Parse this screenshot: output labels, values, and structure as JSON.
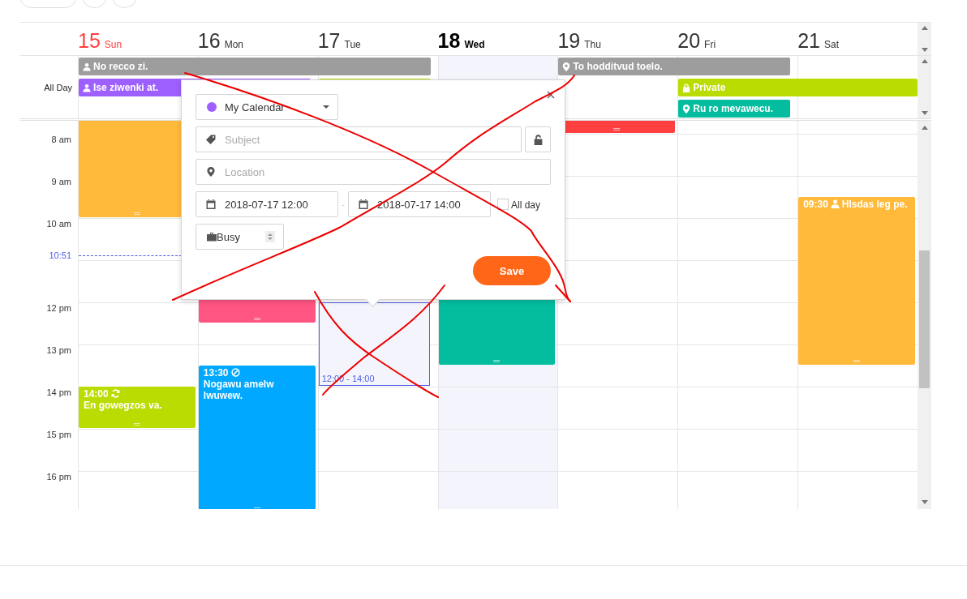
{
  "days": [
    {
      "number": "15",
      "weekday": "Sun",
      "kind": "sunday",
      "events": [
        {
          "color": "#ffba3b"
        },
        {
          "time": "14:00",
          "kind": "repeat",
          "title": "En gowegzos va.",
          "color": "#bbdc00"
        }
      ]
    },
    {
      "number": "16",
      "weekday": "Mon",
      "kind": "weekday",
      "events": [
        {
          "color": "#ff5583"
        },
        {
          "time": "13:30",
          "kind": "ban",
          "title": "Nogawu amelw lwuwew.",
          "color": "#00a9ff"
        }
      ]
    },
    {
      "number": "17",
      "weekday": "Tue",
      "kind": "weekday",
      "events": [
        {
          "kind": "selection",
          "title": "12:00 - 14:00"
        }
      ]
    },
    {
      "number": "18",
      "weekday": "Wed",
      "kind": "today",
      "events": [
        {
          "color": "#03bd9e"
        }
      ]
    },
    {
      "number": "19",
      "weekday": "Thu",
      "kind": "weekday",
      "events": [
        {
          "color": "#ff4040"
        }
      ]
    },
    {
      "number": "20",
      "weekday": "Fri",
      "kind": "weekday"
    },
    {
      "number": "21",
      "weekday": "Sat",
      "kind": "weekday",
      "events": [
        {
          "time": "09:30",
          "kind": "person",
          "title": "Hlsdas leg pe.",
          "color": "#ffba3b"
        }
      ]
    }
  ],
  "all_day_label": "All Day",
  "all_day_events": [
    {
      "kind": "person",
      "title": "No recco zi.",
      "color": "#9d9d9d"
    },
    {
      "kind": "pin",
      "title": "To hodditvud toelo.",
      "color": "#9d9d9d"
    },
    {
      "kind": "person",
      "title": "Ise ziwenki at.",
      "color": "#9e5fff"
    },
    {
      "color": "#bbdc00"
    },
    {
      "kind": "lock",
      "title": "Private",
      "color": "#bbdc00"
    },
    {
      "kind": "pin",
      "title": "Ru ro mevawecu.",
      "color": "#03bd9e"
    }
  ],
  "time_rows": [
    {
      "label": "8 am",
      "kind": "hour"
    },
    {
      "label": "9 am",
      "kind": "hour"
    },
    {
      "label": "10 am",
      "kind": "hour"
    },
    {
      "label": "10:51",
      "kind": "now"
    },
    {
      "label": "12 pm",
      "kind": "hour"
    },
    {
      "label": "13 pm",
      "kind": "hour"
    },
    {
      "label": "14 pm",
      "kind": "hour"
    },
    {
      "label": "15 pm",
      "kind": "hour"
    },
    {
      "label": "16 pm",
      "kind": "hour"
    }
  ],
  "popup": {
    "calendar": {
      "value": "My Calendar",
      "color": "#9e5fff"
    },
    "subject": {
      "placeholder": "Subject"
    },
    "location": {
      "placeholder": "Location"
    },
    "start": "2018-07-17 12:00",
    "separator": "-",
    "end": "2018-07-17 14:00",
    "all_day": {
      "label": "All day",
      "checked": false
    },
    "state": "Busy",
    "save": "Save"
  },
  "annotations": [
    {
      "kind": "scribble"
    }
  ]
}
